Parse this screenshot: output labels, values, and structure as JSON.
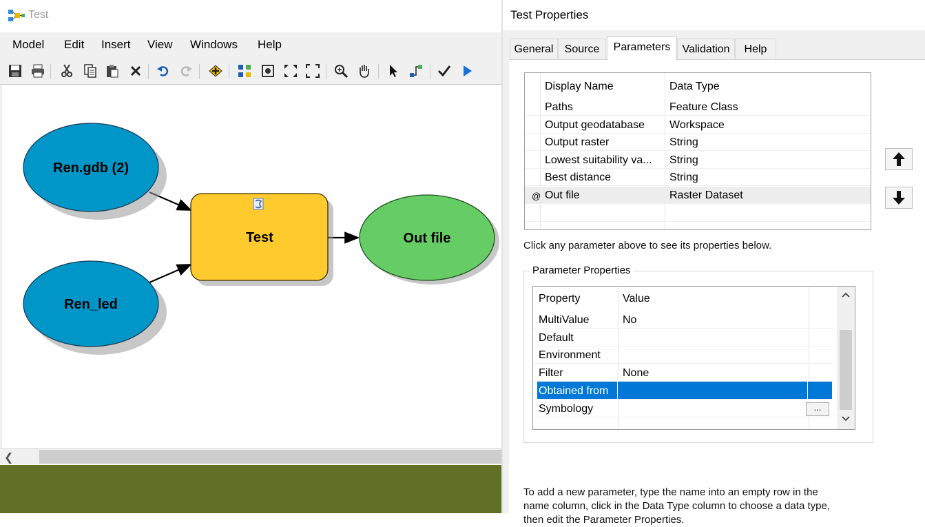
{
  "model_window": {
    "title": "Test",
    "menu": [
      "Model",
      "Edit",
      "Insert",
      "View",
      "Windows",
      "Help"
    ],
    "toolbar_icons": [
      "save-icon",
      "print-icon",
      "cut-icon",
      "copy-icon",
      "paste-icon",
      "delete-icon",
      "undo-icon",
      "redo-icon",
      "add-data-icon",
      "auto-layout-icon",
      "full-extent-icon",
      "zoom-in-fixed-icon",
      "zoom-out-fixed-icon",
      "zoom-icon",
      "pan-icon",
      "select-icon",
      "connect-icon",
      "validate-icon",
      "run-icon"
    ],
    "nodes": {
      "input1": "Ren.gdb (2)",
      "input2": "Ren_led",
      "tool": "Test",
      "output": "Out file"
    },
    "colors": {
      "input": "#0096c8",
      "tool": "#ffca2e",
      "output": "#66cc66",
      "background_strip": "#627025"
    }
  },
  "properties_dialog": {
    "title": "Test Properties",
    "tabs": [
      "General",
      "Source",
      "Parameters",
      "Validation",
      "Help"
    ],
    "active_tab": "Parameters",
    "params_table": {
      "headers": [
        "Display Name",
        "Data Type"
      ],
      "rows": [
        {
          "marker": "",
          "name": "Paths",
          "type": "Feature Class"
        },
        {
          "marker": "",
          "name": "Output geodatabase",
          "type": "Workspace"
        },
        {
          "marker": "",
          "name": "Output raster",
          "type": "String"
        },
        {
          "marker": "",
          "name": "Lowest suitability va...",
          "type": "String"
        },
        {
          "marker": "",
          "name": "Best distance",
          "type": "String"
        },
        {
          "marker": "@",
          "name": "Out file",
          "type": "Raster Dataset"
        }
      ]
    },
    "move_buttons": [
      "arrow-up-icon",
      "arrow-down-icon"
    ],
    "hint_top": "Click any parameter above to see its properties below.",
    "param_props": {
      "group_label": "Parameter Properties",
      "headers": [
        "Property",
        "Value"
      ],
      "rows": [
        {
          "property": "MultiValue",
          "value": "No"
        },
        {
          "property": "Default",
          "value": ""
        },
        {
          "property": "Environment",
          "value": ""
        },
        {
          "property": "Filter",
          "value": "None"
        },
        {
          "property": "Obtained from",
          "value": ""
        },
        {
          "property": "Symbology",
          "value": ""
        }
      ],
      "selected_row": "Obtained from",
      "ellipsis_label": "..."
    },
    "hint_bottom": [
      "To add a new parameter, type the name into an empty row in the",
      "name column, click in the Data Type column to choose a data type,",
      "then edit the Parameter Properties."
    ],
    "selection_color": "#0078d7"
  }
}
